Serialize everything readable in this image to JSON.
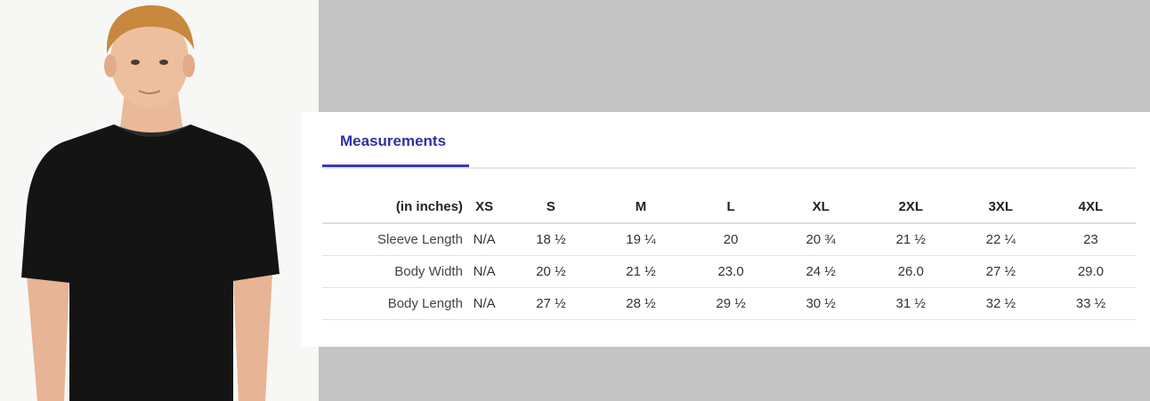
{
  "tabs": {
    "active_label": "Measurements"
  },
  "table": {
    "corner_label": "(in inches)",
    "sizes": [
      "XS",
      "S",
      "M",
      "L",
      "XL",
      "2XL",
      "3XL",
      "4XL"
    ],
    "rows": [
      {
        "label": "Sleeve Length",
        "values": [
          "N/A",
          "18 ½",
          "19 ¼",
          "20",
          "20 ¾",
          "21 ½",
          "22 ¼",
          "23"
        ]
      },
      {
        "label": "Body Width",
        "values": [
          "N/A",
          "20 ½",
          "21 ½",
          "23.0",
          "24 ½",
          "26.0",
          "27 ½",
          "29.0"
        ]
      },
      {
        "label": "Body Length",
        "values": [
          "N/A",
          "27 ½",
          "28 ½",
          "29 ½",
          "30 ½",
          "31 ½",
          "32 ½",
          "33 ½"
        ]
      }
    ]
  },
  "colors": {
    "accent": "#2f2fa6",
    "tab_underline": "#3b3bb5",
    "gray_backdrop": "#c4c4c4",
    "shirt": "#141414"
  },
  "photo": {
    "subject": "model-wearing-black-tshirt"
  }
}
